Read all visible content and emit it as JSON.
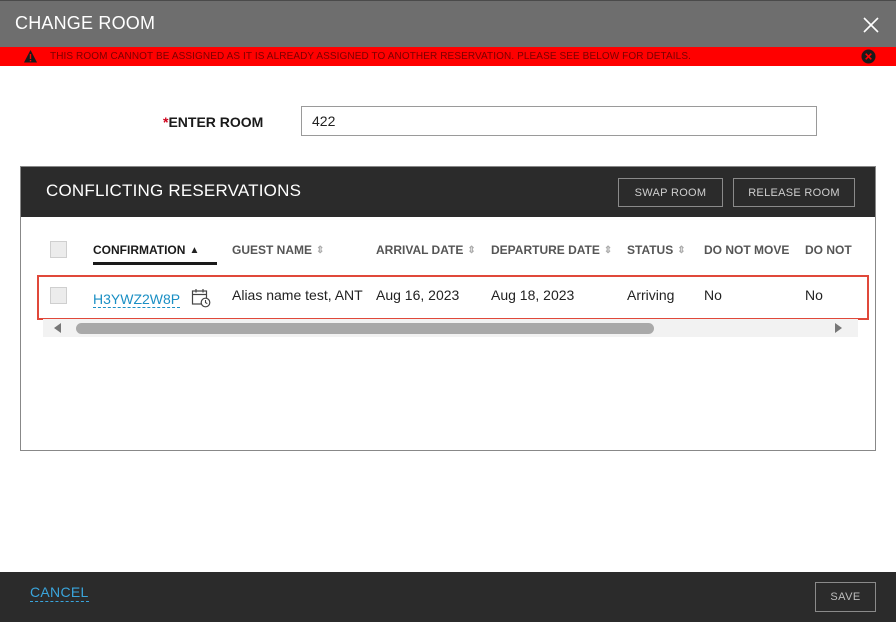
{
  "header": {
    "title": "CHANGE ROOM"
  },
  "banner": {
    "message": "THIS ROOM CANNOT BE ASSIGNED AS IT IS ALREADY ASSIGNED TO ANOTHER RESERVATION. PLEASE SEE BELOW FOR DETAILS.",
    "color": "#ff0000"
  },
  "room": {
    "required_mark": "*",
    "label": "ENTER ROOM",
    "value": "422"
  },
  "conflicts": {
    "title": "CONFLICTING RESERVATIONS",
    "swap_label": "SWAP ROOM",
    "release_label": "RELEASE ROOM",
    "columns": {
      "confirmation": "CONFIRMATION",
      "guest_name": "GUEST NAME",
      "arrival_date": "ARRIVAL DATE",
      "departure_date": "DEPARTURE DATE",
      "status": "STATUS",
      "do_not_move": "DO NOT MOVE",
      "do_not_2": "DO NOT"
    },
    "rows": [
      {
        "confirmation": "H3YWZ2W8P",
        "guest_name": "Alias name test, ANT",
        "arrival_date": "Aug 16, 2023",
        "departure_date": "Aug 18, 2023",
        "status": "Arriving",
        "do_not_move": "No",
        "do_not_2": "No"
      }
    ]
  },
  "footer": {
    "cancel_label": "CANCEL",
    "save_label": "SAVE"
  },
  "icons": {
    "close": "close-icon",
    "warning": "warning-icon",
    "banner_close": "close-circle-icon",
    "calendar": "calendar-clock-icon",
    "sort": "sort-icon"
  },
  "colors": {
    "accent": "#1a8fc4",
    "row_highlight": "#e0483a",
    "header": "#6e6e6e",
    "panel_header": "#2b2b2b"
  }
}
